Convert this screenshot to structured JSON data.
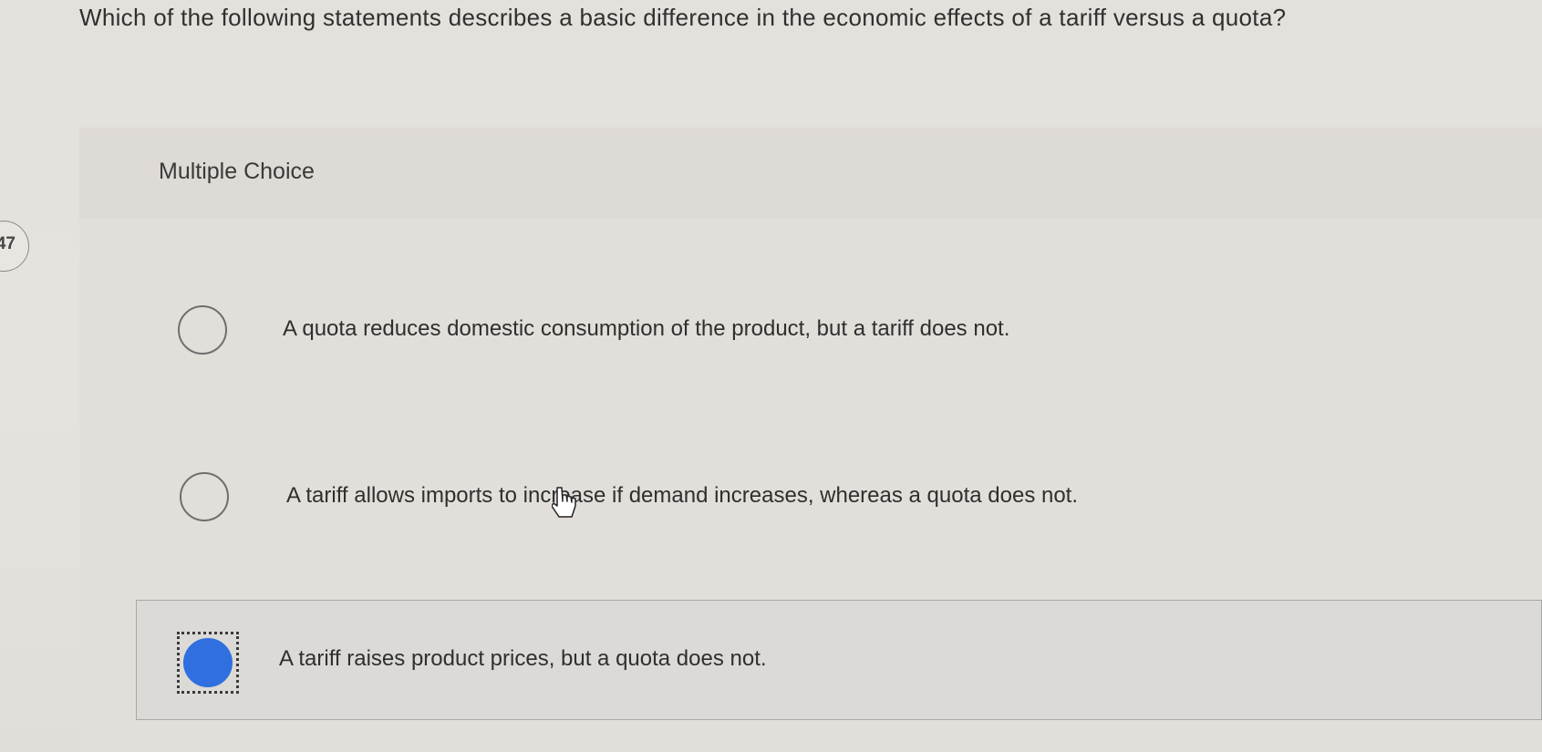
{
  "question": {
    "number": "47",
    "text": "Which of the following statements describes a basic difference in the economic effects of a tariff versus a quota?"
  },
  "panel": {
    "title": "Multiple Choice"
  },
  "options": [
    {
      "label": "A quota reduces domestic consumption of the product, but a tariff does not.",
      "selected": false
    },
    {
      "label": "A tariff allows imports to increase if demand increases, whereas a quota does not.",
      "selected": false
    },
    {
      "label": "A tariff raises product prices, but a quota does not.",
      "selected": true
    }
  ],
  "colors": {
    "selected_radio": "#2f6fe0",
    "background": "#e4e1dc"
  },
  "icons": {
    "cursor": "hand-pointer-icon"
  }
}
